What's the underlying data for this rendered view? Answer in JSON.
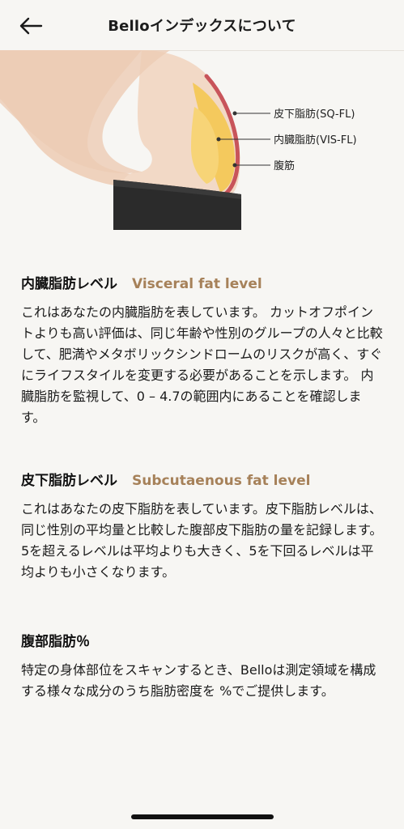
{
  "header": {
    "title": "Belloインデックスについて",
    "back_icon": "arrow-left-icon"
  },
  "figure": {
    "labels": {
      "sq": "皮下脂肪(SQ-FL)",
      "vis": "内臓脂肪(VIS-FL)",
      "muscle": "腹筋"
    },
    "colors": {
      "skin": "#efd2bd",
      "fat": "#f4c95d",
      "muscle": "#c8545a",
      "pants": "#2b2b2b"
    }
  },
  "sections": [
    {
      "title_jp": "内臓脂肪レベル",
      "title_en": "Visceral fat level",
      "body": "これはあなたの内臓脂肪を表しています。 カットオフポイントよりも高い評価は、同じ年齢や性別のグループの人々と比較して、肥満やメタボリックシンドロームのリスクが高く、すぐにライフスタイルを変更する必要があることを示します。 内臓脂肪を監視して、0 – 4.7の範囲内にあることを確認します。"
    },
    {
      "title_jp": "皮下脂肪レベル",
      "title_en": "Subcutaenous fat level",
      "body": "これはあなたの皮下脂肪を表しています。皮下脂肪レベルは、同じ性別の平均量と比較した腹部皮下脂肪の量を記録します。5を超えるレベルは平均よりも大きく、5を下回るレベルは平均よりも小さくなります。"
    },
    {
      "title_jp": "腹部脂肪％",
      "title_en": "",
      "body": "特定の身体部位をスキャンするとき、Belloは測定領域を構成する様々な成分のうち脂肪密度を %でご提供します。"
    }
  ],
  "accent_color": "#a68159"
}
